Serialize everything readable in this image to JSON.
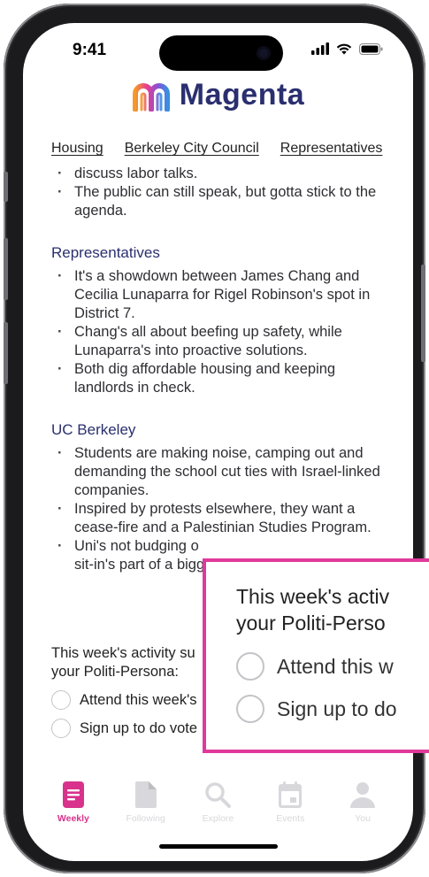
{
  "status_bar": {
    "time": "9:41"
  },
  "brand": {
    "name": "Magenta",
    "logo": "magenta-rainbow-m-logo"
  },
  "topic_tabs": [
    "Housing",
    "Berkeley City Council",
    "Representatives"
  ],
  "city_council_tail": [
    "discuss labor talks.",
    "The public can still speak, but gotta stick to the agenda."
  ],
  "representatives": {
    "heading": "Representatives",
    "bullets": [
      "It's a showdown between James Chang and Cecilia Lunaparra for Rigel Robinson's spot in District 7.",
      "Chang's all about beefing up safety, while Lunaparra's into proactive solutions.",
      "Both dig affordable housing and keeping landlords in check."
    ]
  },
  "uc_berkeley": {
    "heading": "UC Berkeley",
    "bullets": [
      "Students are making noise, camping out and demanding the school cut ties with Israel-linked companies.",
      "Inspired by protests elsewhere, they want a cease-fire and a Palestinian Studies Program.",
      "Uni's not budging o",
      "sit-in's part of a bigg"
    ]
  },
  "survey": {
    "title": "This week's activity su",
    "title_line2": "your Politi-Persona:",
    "options": [
      "Attend this week's",
      "Sign up to do vote"
    ]
  },
  "callout": {
    "title_line1": "This week's activ",
    "title_line2": "your Politi-Perso",
    "options": [
      "Attend this w",
      "Sign up to do"
    ]
  },
  "bottom_nav": [
    {
      "label": "Weekly",
      "icon": "document-icon",
      "active": true
    },
    {
      "label": "Following",
      "icon": "file-icon",
      "active": false
    },
    {
      "label": "Explore",
      "icon": "search-icon",
      "active": false
    },
    {
      "label": "Events",
      "icon": "calendar-icon",
      "active": false
    },
    {
      "label": "You",
      "icon": "person-icon",
      "active": false
    }
  ],
  "colors": {
    "accent": "#D9328C",
    "brand_navy": "#2A2F6F",
    "inactive": "#D8D8DC"
  }
}
